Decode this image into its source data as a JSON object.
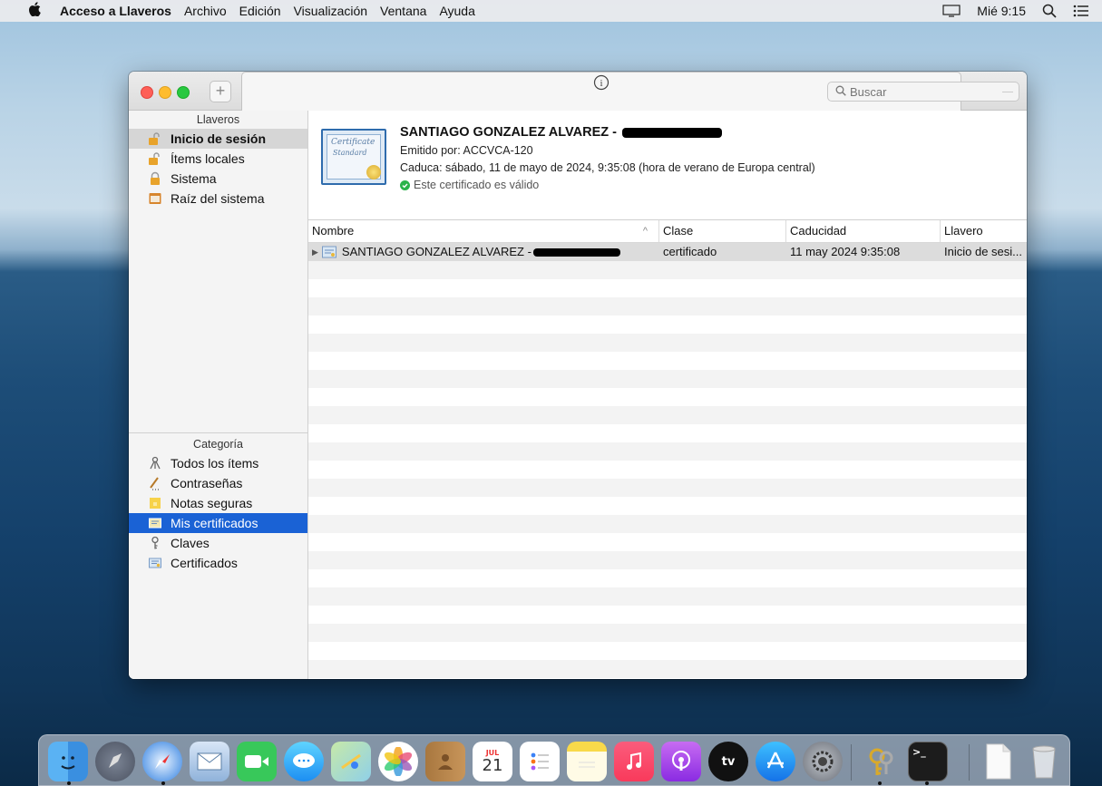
{
  "menubar": {
    "app_name": "Acceso a Llaveros",
    "items": [
      "Archivo",
      "Edición",
      "Visualización",
      "Ventana",
      "Ayuda"
    ],
    "clock": "Mié 9:15"
  },
  "toolbar": {
    "add_label": "+",
    "info_label": "i",
    "search_placeholder": "Buscar"
  },
  "sidebar": {
    "keychains_header": "Llaveros",
    "keychains": [
      {
        "label": "Inicio de sesión",
        "icon": "unlocked-padlock-icon"
      },
      {
        "label": "Ítems locales",
        "icon": "unlocked-padlock-icon"
      },
      {
        "label": "Sistema",
        "icon": "padlock-icon"
      },
      {
        "label": "Raíz del sistema",
        "icon": "cabinet-icon"
      }
    ],
    "categories_header": "Categoría",
    "categories": [
      {
        "label": "Todos los ítems",
        "icon": "keys-icon"
      },
      {
        "label": "Contraseñas",
        "icon": "pen-icon"
      },
      {
        "label": "Notas seguras",
        "icon": "note-icon"
      },
      {
        "label": "Mis certificados",
        "icon": "certificate-icon"
      },
      {
        "label": "Claves",
        "icon": "key-icon"
      },
      {
        "label": "Certificados",
        "icon": "certificate-icon"
      }
    ]
  },
  "certificate": {
    "title": "SANTIAGO GONZALEZ ALVAREZ -",
    "issuer": "Emitido por: ACCVCA-120",
    "expires": "Caduca: sábado, 11 de mayo de 2024, 9:35:08 (hora de verano de Europa central)",
    "status": "Este certificado es válido",
    "thumb_text_1": "Certificate",
    "thumb_text_2": "Standard"
  },
  "table": {
    "columns": [
      "Nombre",
      "Clase",
      "Caducidad",
      "Llavero"
    ],
    "rows": [
      {
        "name": "SANTIAGO GONZALEZ ALVAREZ -",
        "kind": "certificado",
        "expiry": "11 may 2024 9:35:08",
        "keychain": "Inicio de sesi..."
      }
    ]
  },
  "dock": {
    "apps": [
      "Finder",
      "Launchpad",
      "Safari",
      "Mail",
      "FaceTime",
      "Mensajes",
      "Mapas",
      "Fotos",
      "Contactos",
      "Calendario",
      "Recordatorios",
      "Notas",
      "Música",
      "Podcasts",
      "TV",
      "App Store",
      "Preferencias del Sistema",
      "Acceso a Llaveros",
      "Terminal",
      "Documento",
      "Papelera"
    ],
    "calendar_month": "JUL",
    "calendar_day": "21",
    "tv_label": "tv"
  },
  "colors": {
    "selection": "#1a62d5",
    "valid_green": "#2bb34b"
  }
}
